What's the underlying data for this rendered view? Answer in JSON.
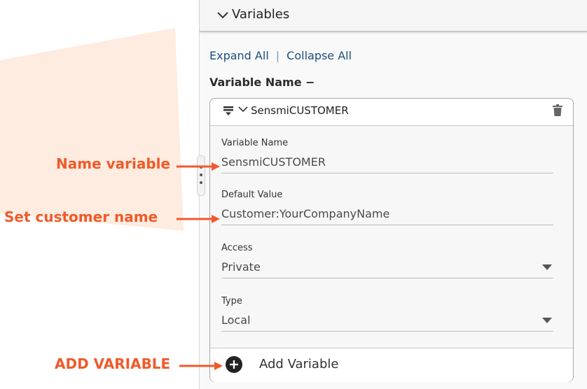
{
  "colors": {
    "accent_orange": "#f05a2a",
    "background_blob": "#fdecdf",
    "link_blue": "#1c4f7c",
    "panel_bg": "#f9f9f9"
  },
  "panel": {
    "header_title": "Variables",
    "expand_all": "Expand All",
    "separator": "|",
    "collapse_all": "Collapse All",
    "section_heading": "Variable Name",
    "section_heading_suffix": "−"
  },
  "variable_card": {
    "title": "SensmiCUSTOMER",
    "icons": [
      "drag-handle-icon",
      "chevron-down-icon",
      "trash-icon"
    ],
    "fields": {
      "name": {
        "label": "Variable Name",
        "value": "SensmiCUSTOMER"
      },
      "default": {
        "label": "Default Value",
        "value": "Customer:YourCompanyName"
      },
      "access": {
        "label": "Access",
        "value": "Private"
      },
      "type": {
        "label": "Type",
        "value": "Local"
      }
    },
    "add_button": {
      "label": "Add Variable",
      "icon": "plus-circle-icon"
    }
  },
  "annotations": {
    "name_variable": "Name variable",
    "set_customer": "Set customer name",
    "add_variable": "ADD VARIABLE"
  }
}
